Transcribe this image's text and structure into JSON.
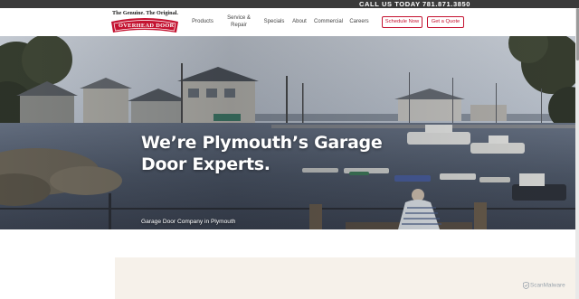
{
  "top_bar": {
    "call_label": "CALL US TODAY",
    "phone": "781.871.3850"
  },
  "logo": {
    "tagline": "The Genuine. The Original.",
    "brand_text": "OVERHEAD DOOR"
  },
  "nav": {
    "items": [
      {
        "label": "Products"
      },
      {
        "label": "Service & Repair"
      },
      {
        "label": "Specials"
      },
      {
        "label": "About"
      },
      {
        "label": "Commercial"
      },
      {
        "label": "Careers"
      }
    ],
    "schedule_label": "Schedule Now",
    "quote_label": "Get a Quote"
  },
  "hero": {
    "headline": "We’re Plymouth’s Garage Door Experts.",
    "subheading": "Garage Door Company in Plymouth"
  },
  "badge": {
    "label": "ScanMalware",
    "icon": "shield-icon"
  },
  "colors": {
    "accent": "#c41230",
    "top_bar": "#3a3a3a",
    "panel": "#f6f1ea"
  }
}
